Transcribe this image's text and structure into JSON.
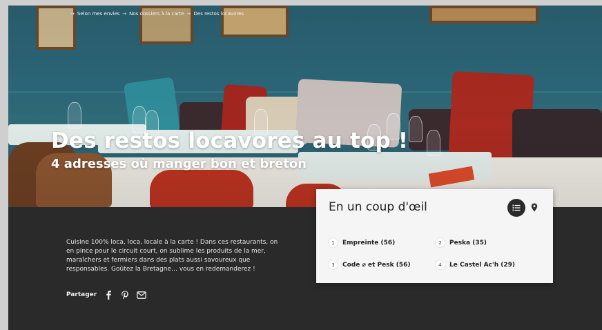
{
  "breadcrumb": {
    "items": [
      "Selon mes envies",
      "Nos dossiers à la carte",
      "Des restos locavores"
    ]
  },
  "hero": {
    "title": "Des restos locavores au top !",
    "subtitle": "4 adresses où manger bon et breton"
  },
  "intro": {
    "text": "Cuisine 100% loca, loca, locale à la carte ! Dans ces restaurants, on en pince pour le circuit court, on sublime les produits de la mer, maraîchers et fermiers dans des plats aussi savoureux que responsables. Goûtez la Bretagne… vous en redemanderez !"
  },
  "share": {
    "label": "Partager",
    "icons": [
      "facebook-icon",
      "pinterest-icon",
      "email-icon"
    ]
  },
  "summary": {
    "title": "En un coup d'œil",
    "view_icons": [
      "list-icon",
      "map-pin-icon"
    ],
    "items": [
      {
        "number": "1",
        "label": "Empreinte (56)"
      },
      {
        "number": "2",
        "label": "Peska (35)"
      },
      {
        "number": "3",
        "label": "Code ⌀ et Pesk (56)"
      },
      {
        "number": "4",
        "label": "Le Castel Ac'h (29)"
      }
    ]
  },
  "colors": {
    "dark_bg": "#2a2a2a",
    "card_bg": "#f5f5f5",
    "text_light": "#e6e6e6"
  }
}
